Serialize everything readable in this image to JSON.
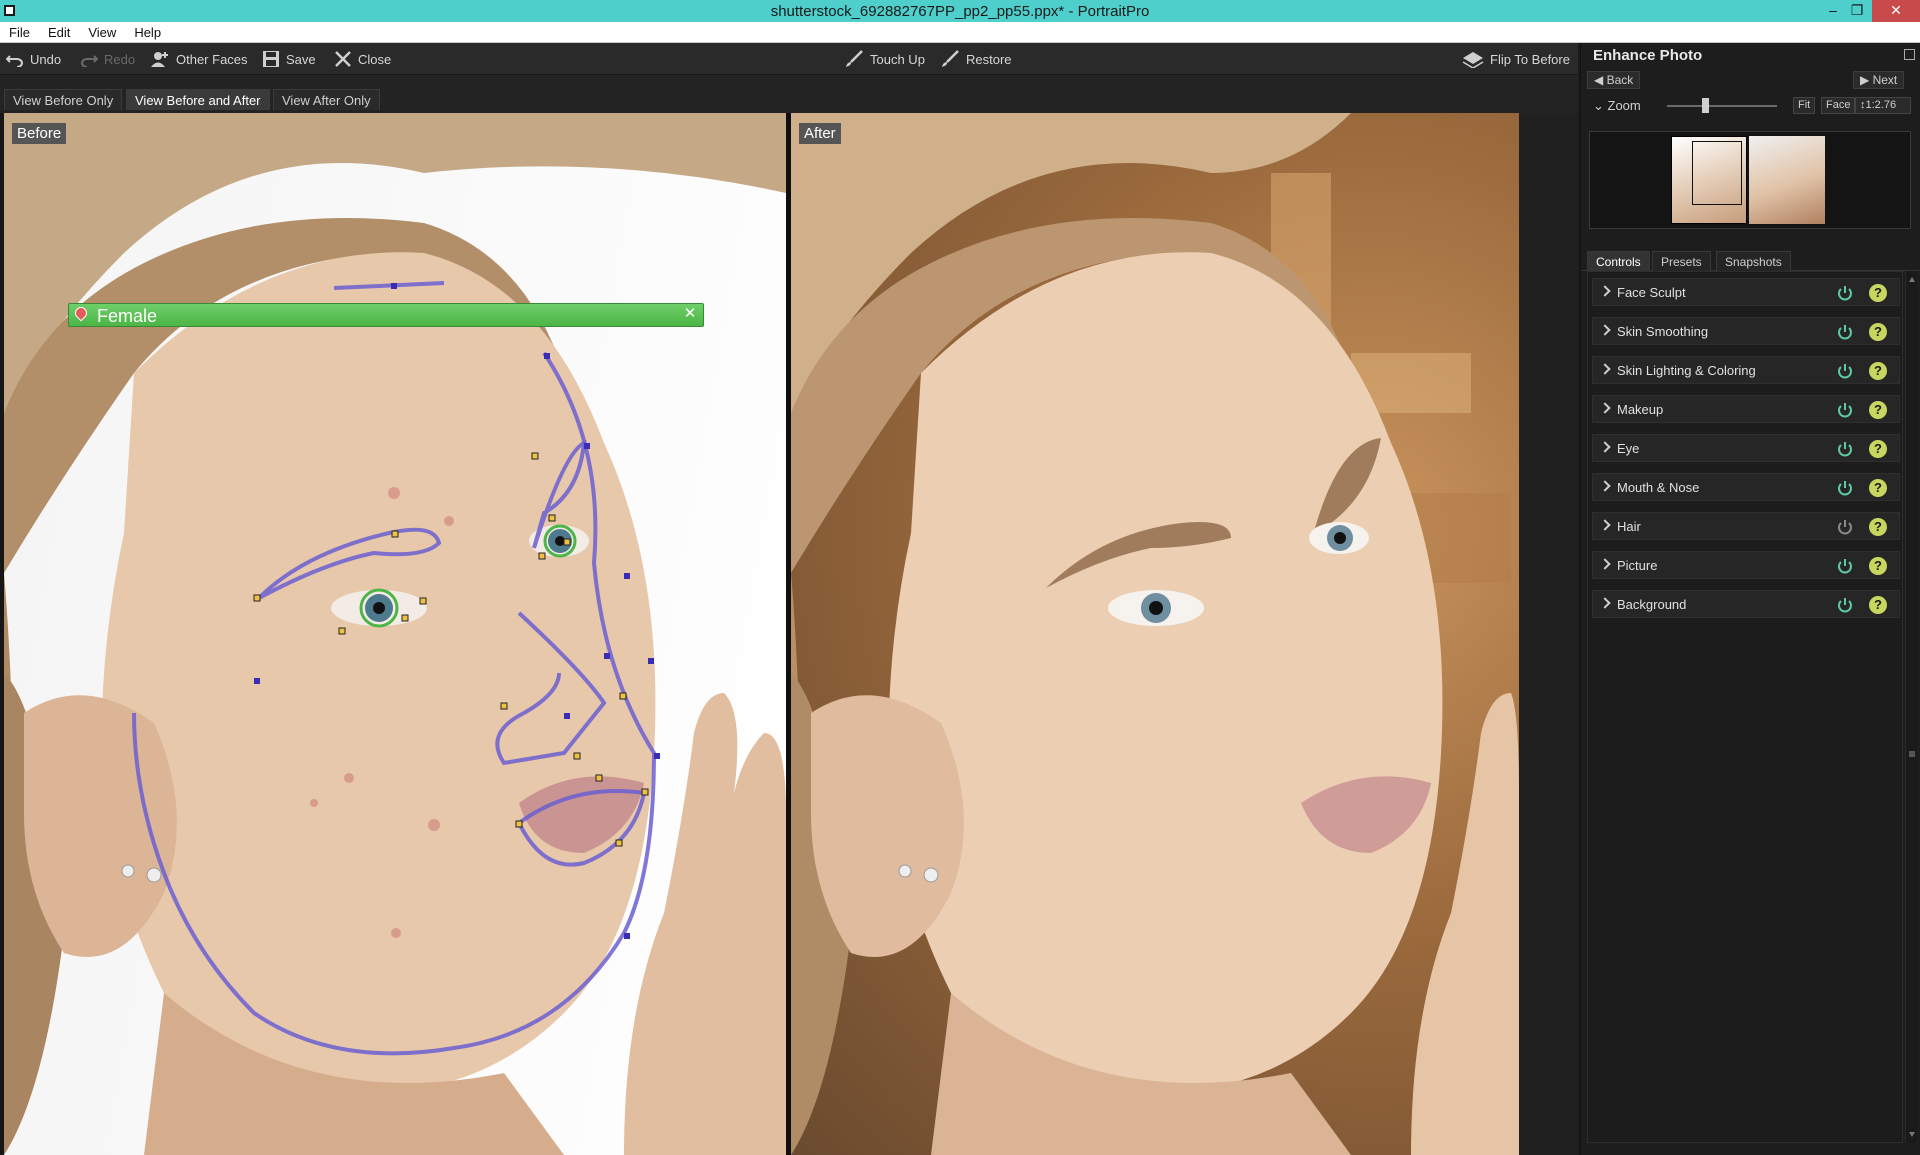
{
  "window": {
    "title": "shutterstock_692882767PP_pp2_pp55.ppx* - PortraitPro"
  },
  "menu": [
    "File",
    "Edit",
    "View",
    "Help"
  ],
  "toolbar": {
    "undo": "Undo",
    "redo": "Redo",
    "other_faces": "Other Faces",
    "save": "Save",
    "close": "Close",
    "touch_up": "Touch Up",
    "restore": "Restore",
    "flip": "Flip To Before"
  },
  "view_tabs": [
    "View Before Only",
    "View Before and After",
    "View After Only"
  ],
  "panes": {
    "before_label": "Before",
    "after_label": "After",
    "gender_label": "Female"
  },
  "right_panel": {
    "title": "Enhance Photo",
    "back": "Back",
    "next": "Next",
    "zoom_label": "Zoom",
    "zoom_level": 0.35,
    "fit": "Fit",
    "face": "Face",
    "zoom_ratio": "1:2.76",
    "tabs": [
      "Controls",
      "Presets",
      "Snapshots"
    ],
    "active_tab": "Controls",
    "controls": [
      {
        "label": "Face Sculpt",
        "power_color": "#5fc9a0"
      },
      {
        "label": "Skin Smoothing",
        "power_color": "#5fc9a0"
      },
      {
        "label": "Skin Lighting & Coloring",
        "power_color": "#5fc9a0"
      },
      {
        "label": "Makeup",
        "power_color": "#5fc9a0"
      },
      {
        "label": "Eye",
        "power_color": "#5fc9a0"
      },
      {
        "label": "Mouth & Nose",
        "power_color": "#5fc9a0"
      },
      {
        "label": "Hair",
        "power_color": "#8a8a8a"
      },
      {
        "label": "Picture",
        "power_color": "#5fc9a0"
      },
      {
        "label": "Background",
        "power_color": "#5fc9a0"
      }
    ]
  },
  "colors": {
    "titlebar": "#4ecfcb",
    "accent_green": "#4bb545",
    "help_yellow": "#c7d65f",
    "face_outline": "#6a5fd0"
  }
}
